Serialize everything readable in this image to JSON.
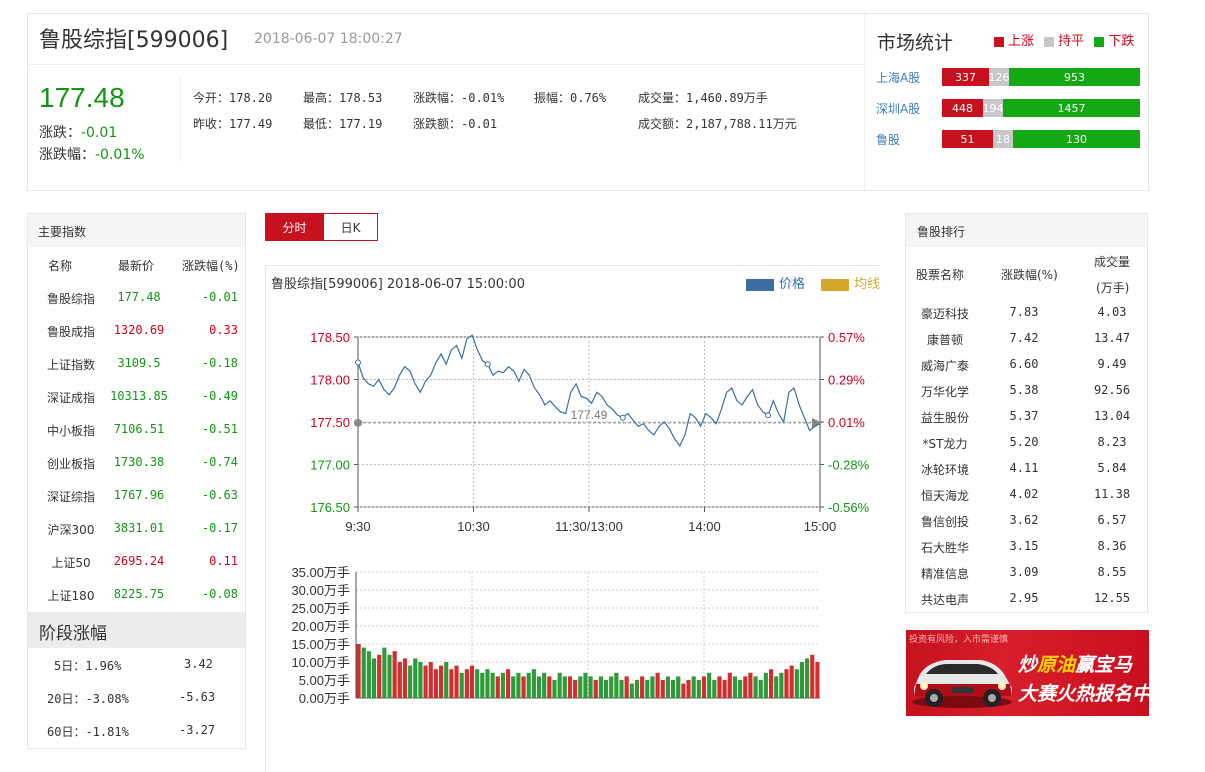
{
  "header": {
    "title": "鲁股综指[599006]",
    "time": "2018-06-07 18:00:27",
    "price": "177.48",
    "change_label": "涨跌：",
    "change_value": "-0.01",
    "pct_label": "涨跌幅：",
    "pct_value": "-0.01%",
    "stats": {
      "open": "今开：178.20",
      "high": "最高：178.53",
      "chg_pct": "涨跌幅：-0.01%",
      "amplitude": "振幅：0.76%",
      "volume": "成交量：1,460.89万手",
      "prev_close": "昨收：177.49",
      "low": "最低：177.19",
      "chg_amt": "涨跌额：-0.01",
      "turnover": "成交额：2,187,788.11万元"
    }
  },
  "market": {
    "title": "市场统计",
    "legend": {
      "up": "上涨",
      "flat": "持平",
      "down": "下跌"
    },
    "colors": {
      "up": "#c8111f",
      "flat": "#c8c8c8",
      "down": "#14a814"
    },
    "rows": [
      {
        "label": "上海A股",
        "up": "337",
        "flat": "126",
        "down": "953"
      },
      {
        "label": "深圳A股",
        "up": "448",
        "flat": "194",
        "down": "1457"
      },
      {
        "label": "鲁股",
        "up": "51",
        "flat": "18",
        "down": "130"
      }
    ]
  },
  "indices": {
    "title": "主要指数",
    "headers": [
      "名称",
      "最新价",
      "涨跌幅(%)"
    ],
    "rows": [
      {
        "name": "鲁股综指",
        "price": "177.48",
        "pct": "-0.01",
        "dir": "down"
      },
      {
        "name": "鲁股成指",
        "price": "1320.69",
        "pct": "0.33",
        "dir": "up"
      },
      {
        "name": "上证指数",
        "price": "3109.5",
        "pct": "-0.18",
        "dir": "down"
      },
      {
        "name": "深证成指",
        "price": "10313.85",
        "pct": "-0.49",
        "dir": "down"
      },
      {
        "name": "中小板指",
        "price": "7106.51",
        "pct": "-0.51",
        "dir": "down"
      },
      {
        "name": "创业板指",
        "price": "1730.38",
        "pct": "-0.74",
        "dir": "down"
      },
      {
        "name": "深证综指",
        "price": "1767.96",
        "pct": "-0.63",
        "dir": "down"
      },
      {
        "name": "沪深300",
        "price": "3831.01",
        "pct": "-0.17",
        "dir": "down"
      },
      {
        "name": "上证50",
        "price": "2695.24",
        "pct": "0.11",
        "dir": "up"
      },
      {
        "name": "上证180",
        "price": "8225.75",
        "pct": "-0.08",
        "dir": "down"
      }
    ]
  },
  "stage": {
    "title": "阶段涨幅",
    "rows": [
      {
        "period": "5日：1.96%",
        "value": "3.42"
      },
      {
        "period": "20日：-3.08%",
        "value": "-5.63"
      },
      {
        "period": "60日：-1.81%",
        "value": "-3.27"
      }
    ]
  },
  "tabs": {
    "intraday": "分时",
    "daily": "日K"
  },
  "chart_header": {
    "title": "鲁股综指[599006] 2018-06-07 15:00:00",
    "legend_price": "价格",
    "legend_avg": "均线",
    "price_color": "#3a6ea5",
    "avg_color": "#d4a72c"
  },
  "chart_data": [
    {
      "type": "line",
      "x_ticks": [
        "9:30",
        "10:30",
        "11:30/13:00",
        "14:00",
        "15:00"
      ],
      "y_ticks_left": [
        "178.50",
        "178.00",
        "177.50",
        "177.00",
        "176.50"
      ],
      "y_ticks_right": [
        "0.57%",
        "0.29%",
        "0.01%",
        "-0.28%",
        "-0.56%"
      ],
      "ylim": [
        176.5,
        178.5
      ],
      "prev_close": 177.49,
      "prev_close_label": "177.49",
      "series": [
        {
          "values": [
            178.2,
            178.02,
            177.95,
            177.92,
            178.0,
            177.88,
            177.82,
            177.9,
            178.05,
            178.15,
            178.1,
            177.95,
            177.85,
            177.98,
            178.05,
            178.2,
            178.3,
            178.18,
            178.35,
            178.4,
            178.25,
            178.48,
            178.52,
            178.35,
            178.22,
            178.18,
            178.05,
            178.1,
            178.08,
            178.15,
            178.1,
            177.98,
            178.12,
            178.05,
            177.9,
            177.82,
            177.7,
            177.75,
            177.68,
            177.62,
            177.6,
            177.85,
            177.95,
            177.8,
            177.78,
            177.72,
            177.85,
            177.8,
            177.7,
            177.65,
            177.58,
            177.55,
            177.6,
            177.52,
            177.45,
            177.48,
            177.4,
            177.35,
            177.45,
            177.5,
            177.42,
            177.3,
            177.22,
            177.35,
            177.6,
            177.55,
            177.45,
            177.6,
            177.55,
            177.48,
            177.65,
            177.85,
            177.9,
            177.75,
            177.7,
            177.8,
            177.88,
            177.7,
            177.62,
            177.58,
            177.75,
            177.6,
            177.5,
            177.85,
            177.9,
            177.7,
            177.55,
            177.4,
            177.45,
            177.48
          ]
        }
      ]
    },
    {
      "type": "bar",
      "y_ticks": [
        "35.00万手",
        "30.00万手",
        "25.00万手",
        "20.00万手",
        "15.00万手",
        "10.00万手",
        "5.00万手",
        "0.00万手"
      ],
      "ylim": [
        0,
        35
      ],
      "values": [
        15,
        14,
        13,
        11,
        12,
        14,
        12,
        13,
        10,
        11,
        9,
        11,
        10,
        9,
        10,
        8,
        9,
        10,
        8,
        9,
        7,
        8,
        9,
        8,
        7,
        8,
        7,
        6,
        7,
        8,
        6,
        7,
        6,
        7,
        8,
        6,
        7,
        6,
        5,
        7,
        6,
        6,
        5,
        6,
        7,
        6,
        5,
        6,
        5,
        6,
        7,
        5,
        6,
        4,
        5,
        6,
        5,
        6,
        7,
        5,
        6,
        5,
        6,
        4,
        5,
        6,
        5,
        6,
        7,
        5,
        6,
        5,
        7,
        6,
        5,
        6,
        7,
        6,
        5,
        7,
        8,
        6,
        7,
        8,
        9,
        8,
        10,
        11,
        12,
        10
      ],
      "colors_by": "direction"
    }
  ],
  "ranking": {
    "title": "鲁股排行",
    "headers": [
      "股票名称",
      "涨跌幅(%)",
      "成交量",
      "(万手)"
    ],
    "rows": [
      {
        "name": "豪迈科技",
        "pct": "7.83",
        "vol": "4.03"
      },
      {
        "name": "康普顿",
        "pct": "7.42",
        "vol": "13.47"
      },
      {
        "name": "威海广泰",
        "pct": "6.60",
        "vol": "9.49"
      },
      {
        "name": "万华化学",
        "pct": "5.38",
        "vol": "92.56"
      },
      {
        "name": "益生股份",
        "pct": "5.37",
        "vol": "13.04"
      },
      {
        "name": "*ST龙力",
        "pct": "5.20",
        "vol": "8.23"
      },
      {
        "name": "冰轮环境",
        "pct": "4.11",
        "vol": "5.84"
      },
      {
        "name": "恒天海龙",
        "pct": "4.02",
        "vol": "11.38"
      },
      {
        "name": "鲁信创投",
        "pct": "3.62",
        "vol": "6.57"
      },
      {
        "name": "石大胜华",
        "pct": "3.15",
        "vol": "8.36"
      },
      {
        "name": "精准信息",
        "pct": "3.09",
        "vol": "8.55"
      },
      {
        "name": "共达电声",
        "pct": "2.95",
        "vol": "12.55"
      }
    ]
  },
  "ad": {
    "warning": "投资有风险，入市需谨慎",
    "line1_a": "炒",
    "line1_hl": "原油",
    "line1_b": "赢宝马",
    "line2": "大赛火热报名中"
  }
}
